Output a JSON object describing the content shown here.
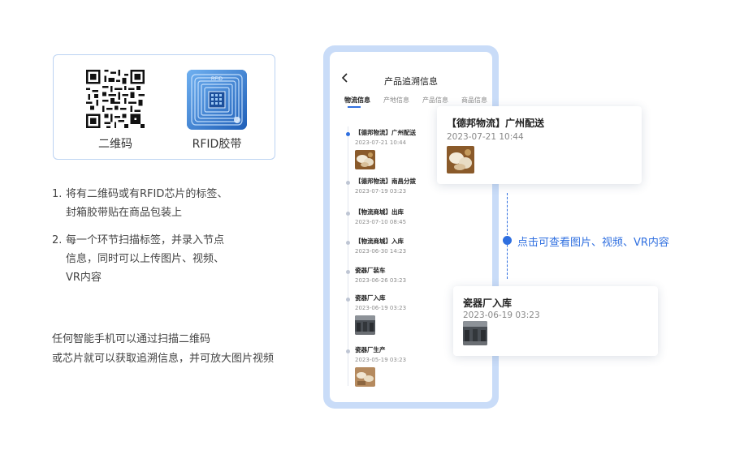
{
  "tag_card": {
    "qr_label": "二维码",
    "rfid_label": "RFID胶带",
    "rfid_chip_text": "RFID"
  },
  "steps": [
    {
      "num": "1.",
      "lines": [
        "将有二维码或有RFID芯片的标签、",
        "封箱胶带贴在商品包装上"
      ]
    },
    {
      "num": "2.",
      "lines": [
        "每一个环节扫描标签，并录入节点",
        "信息，同时可以上传图片、视频、",
        "VR内容"
      ]
    }
  ],
  "note": {
    "lines": [
      "任何智能手机可以通过扫描二维码",
      "或芯片就可以获取追溯信息，并可放大图片视频"
    ]
  },
  "phone": {
    "title": "产品追溯信息",
    "tabs": [
      "物流信息",
      "产地信息",
      "产品信息",
      "商品信息"
    ],
    "timeline": [
      {
        "title": "【德邦物流】广州配送",
        "time": "2023-07-21  10:44",
        "thumb": "tableware"
      },
      {
        "title": "【德邦物流】南昌分拨",
        "time": "2023-07-19  03:23",
        "thumb": ""
      },
      {
        "title": "【物流商城】出库",
        "time": "2023-07-10  08:45",
        "thumb": ""
      },
      {
        "title": "【物流商城】入库",
        "time": "2023-06-30  14:23",
        "thumb": ""
      },
      {
        "title": "瓷器厂装车",
        "time": "2023-06-26  03:23",
        "thumb": ""
      },
      {
        "title": "瓷器厂入库",
        "time": "2023-06-19  03:23",
        "thumb": "warehouse"
      },
      {
        "title": "瓷器厂生产",
        "time": "2023-05-19  03:23",
        "thumb": "production"
      }
    ]
  },
  "callouts": {
    "first": {
      "title": "【德邦物流】广州配送",
      "time": "2023-07-21  10:44"
    },
    "second": {
      "title": "瓷器厂入库",
      "time": "2023-06-19  03:23"
    }
  },
  "hint": {
    "text": "点击可查看图片、视频、VR内容"
  },
  "colors": {
    "accent": "#2f6fe0",
    "phone_frame": "#c9dcf8",
    "card_border": "#bcd3f2"
  }
}
